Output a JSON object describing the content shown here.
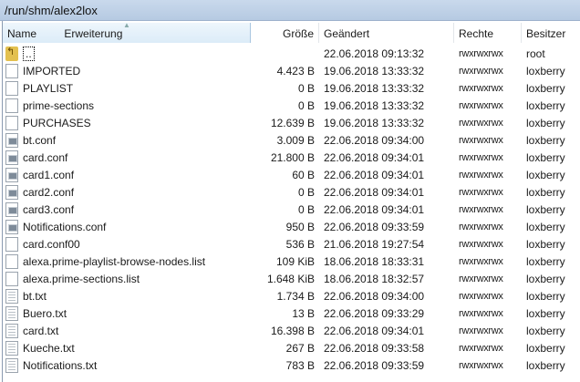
{
  "title": "/run/shm/alex2lox",
  "columns": {
    "name": "Name",
    "ext": "Erweiterung",
    "size": "Größe",
    "date": "Geändert",
    "perm": "Rechte",
    "owner": "Besitzer"
  },
  "files": [
    {
      "name": "..",
      "size": "",
      "date": "22.06.2018 09:13:32",
      "perm": "rwxrwxrwx",
      "owner": "root",
      "icon": "up"
    },
    {
      "name": "IMPORTED",
      "size": "4.423 B",
      "date": "19.06.2018 13:33:32",
      "perm": "rwxrwxrwx",
      "owner": "loxberry",
      "icon": "file"
    },
    {
      "name": "PLAYLIST",
      "size": "0 B",
      "date": "19.06.2018 13:33:32",
      "perm": "rwxrwxrwx",
      "owner": "loxberry",
      "icon": "file"
    },
    {
      "name": "prime-sections",
      "size": "0 B",
      "date": "19.06.2018 13:33:32",
      "perm": "rwxrwxrwx",
      "owner": "loxberry",
      "icon": "file"
    },
    {
      "name": "PURCHASES",
      "size": "12.639 B",
      "date": "19.06.2018 13:33:32",
      "perm": "rwxrwxrwx",
      "owner": "loxberry",
      "icon": "file"
    },
    {
      "name": "bt.conf",
      "size": "3.009 B",
      "date": "22.06.2018 09:34:00",
      "perm": "rwxrwxrwx",
      "owner": "loxberry",
      "icon": "conf"
    },
    {
      "name": "card.conf",
      "size": "21.800 B",
      "date": "22.06.2018 09:34:01",
      "perm": "rwxrwxrwx",
      "owner": "loxberry",
      "icon": "conf"
    },
    {
      "name": "card1.conf",
      "size": "60 B",
      "date": "22.06.2018 09:34:01",
      "perm": "rwxrwxrwx",
      "owner": "loxberry",
      "icon": "conf"
    },
    {
      "name": "card2.conf",
      "size": "0 B",
      "date": "22.06.2018 09:34:01",
      "perm": "rwxrwxrwx",
      "owner": "loxberry",
      "icon": "conf"
    },
    {
      "name": "card3.conf",
      "size": "0 B",
      "date": "22.06.2018 09:34:01",
      "perm": "rwxrwxrwx",
      "owner": "loxberry",
      "icon": "conf"
    },
    {
      "name": "Notifications.conf",
      "size": "950 B",
      "date": "22.06.2018 09:33:59",
      "perm": "rwxrwxrwx",
      "owner": "loxberry",
      "icon": "conf"
    },
    {
      "name": "card.conf00",
      "size": "536 B",
      "date": "21.06.2018 19:27:54",
      "perm": "rwxrwxrwx",
      "owner": "loxberry",
      "icon": "file"
    },
    {
      "name": "alexa.prime-playlist-browse-nodes.list",
      "size": "109 KiB",
      "date": "18.06.2018 18:33:31",
      "perm": "rwxrwxrwx",
      "owner": "loxberry",
      "icon": "file"
    },
    {
      "name": "alexa.prime-sections.list",
      "size": "1.648 KiB",
      "date": "18.06.2018 18:32:57",
      "perm": "rwxrwxrwx",
      "owner": "loxberry",
      "icon": "file"
    },
    {
      "name": "bt.txt",
      "size": "1.734 B",
      "date": "22.06.2018 09:34:00",
      "perm": "rwxrwxrwx",
      "owner": "loxberry",
      "icon": "txt"
    },
    {
      "name": "Buero.txt",
      "size": "13 B",
      "date": "22.06.2018 09:33:29",
      "perm": "rwxrwxrwx",
      "owner": "loxberry",
      "icon": "txt"
    },
    {
      "name": "card.txt",
      "size": "16.398 B",
      "date": "22.06.2018 09:34:01",
      "perm": "rwxrwxrwx",
      "owner": "loxberry",
      "icon": "txt"
    },
    {
      "name": "Kueche.txt",
      "size": "267 B",
      "date": "22.06.2018 09:33:58",
      "perm": "rwxrwxrwx",
      "owner": "loxberry",
      "icon": "txt"
    },
    {
      "name": "Notifications.txt",
      "size": "783 B",
      "date": "22.06.2018 09:33:59",
      "perm": "rwxrwxrwx",
      "owner": "loxberry",
      "icon": "txt"
    }
  ]
}
